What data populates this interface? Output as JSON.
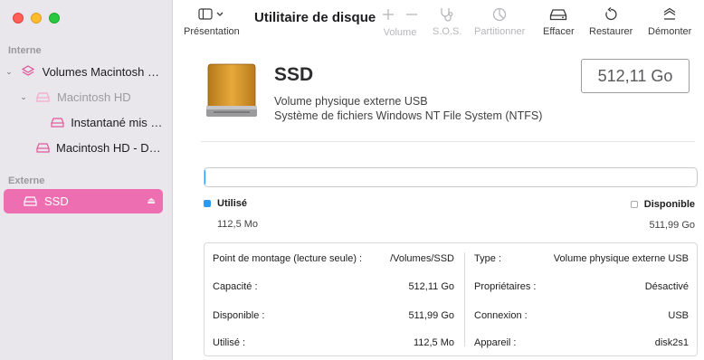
{
  "toolbar": {
    "presentation_label": "Présentation",
    "title": "Utilitaire de disque",
    "volume_label": "Volume",
    "sos_label": "S.O.S.",
    "partition_label": "Partitionner",
    "erase_label": "Effacer",
    "restore_label": "Restaurer",
    "unmount_label": "Démonter"
  },
  "sidebar": {
    "internal_label": "Interne",
    "external_label": "Externe",
    "items": [
      {
        "label": "Volumes Macintosh HD",
        "icon": "layers-icon"
      },
      {
        "label": "Macintosh HD",
        "icon": "drive-icon"
      },
      {
        "label": "Instantané mis à jour",
        "icon": "drive-icon"
      },
      {
        "label": "Macintosh HD - Données",
        "icon": "drive-icon"
      },
      {
        "label": "SSD",
        "icon": "drive-icon"
      }
    ]
  },
  "drive": {
    "name": "SSD",
    "line1": "Volume physique externe USB",
    "line2": "Système de fichiers Windows NT File System (NTFS)",
    "capacity": "512,11 Go"
  },
  "usage": {
    "used_fraction": 0.0002,
    "used_title": "Utilisé",
    "used_value": "112,5 Mo",
    "free_title": "Disponible",
    "free_value": "511,99 Go"
  },
  "info": {
    "left": [
      {
        "key": "Point de montage (lecture seule) :",
        "value": "/Volumes/SSD"
      },
      {
        "key": "Capacité :",
        "value": "512,11 Go"
      },
      {
        "key": "Disponible :",
        "value": "511,99 Go"
      },
      {
        "key": "Utilisé :",
        "value": "112,5 Mo"
      }
    ],
    "right": [
      {
        "key": "Type :",
        "value": "Volume physique externe USB"
      },
      {
        "key": "Propriétaires :",
        "value": "Désactivé"
      },
      {
        "key": "Connexion :",
        "value": "USB"
      },
      {
        "key": "Appareil :",
        "value": "disk2s1"
      }
    ]
  },
  "colors": {
    "accent": "#ee6fb1",
    "used": "#2b9af3"
  }
}
